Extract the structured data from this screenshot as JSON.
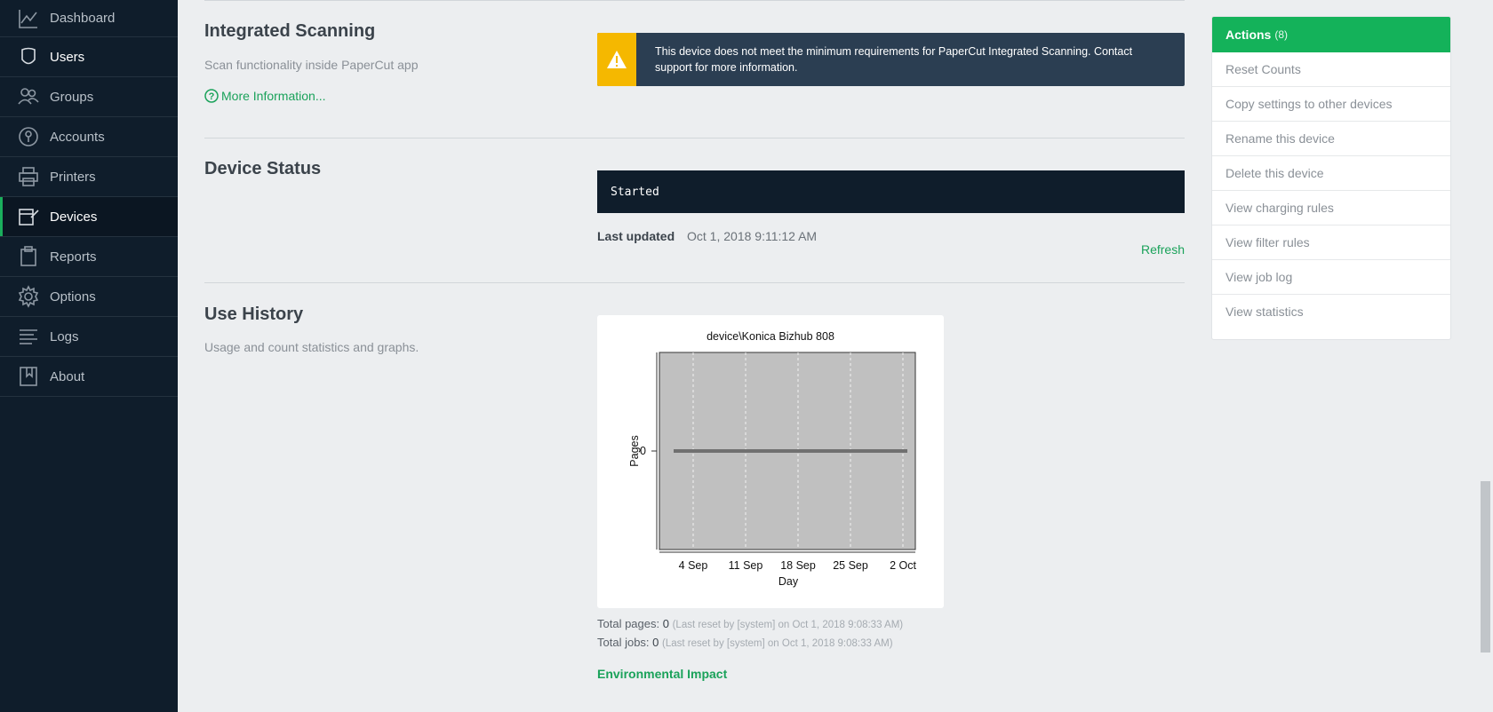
{
  "sidebar": {
    "items": [
      {
        "label": "Dashboard",
        "icon": "chart-line-icon"
      },
      {
        "label": "Users",
        "icon": "user-icon"
      },
      {
        "label": "Groups",
        "icon": "group-icon"
      },
      {
        "label": "Accounts",
        "icon": "account-icon"
      },
      {
        "label": "Printers",
        "icon": "printer-icon"
      },
      {
        "label": "Devices",
        "icon": "device-icon"
      },
      {
        "label": "Reports",
        "icon": "clipboard-icon"
      },
      {
        "label": "Options",
        "icon": "gear-icon"
      },
      {
        "label": "Logs",
        "icon": "list-icon"
      },
      {
        "label": "About",
        "icon": "book-icon"
      }
    ],
    "active": "Devices"
  },
  "scanning": {
    "title": "Integrated Scanning",
    "desc": "Scan functionality inside PaperCut app",
    "more_link": "More Information...",
    "warning": "This device does not meet the minimum requirements for PaperCut Integrated Scanning. Contact support for more information."
  },
  "status": {
    "title": "Device Status",
    "value": "Started",
    "last_updated_label": "Last updated",
    "last_updated_value": "Oct 1, 2018 9:11:12 AM",
    "refresh": "Refresh"
  },
  "history": {
    "title": "Use History",
    "desc": "Usage and count statistics and graphs.",
    "total_pages_label": "Total pages:",
    "total_pages_value": "0",
    "total_pages_note": "(Last reset by [system] on Oct 1, 2018 9:08:33 AM)",
    "total_jobs_label": "Total jobs:",
    "total_jobs_value": "0",
    "total_jobs_note": "(Last reset by [system] on Oct 1, 2018 9:08:33 AM)",
    "env_link": "Environmental Impact"
  },
  "chart_data": {
    "type": "line",
    "title": "device\\Konica Bizhub 808",
    "xlabel": "Day",
    "ylabel": "Pages",
    "x_ticks": [
      "4 Sep",
      "11 Sep",
      "18 Sep",
      "25 Sep",
      "2 Oct"
    ],
    "y_ticks": [
      "0"
    ],
    "x": [
      "1 Sep",
      "2 Oct"
    ],
    "values": [
      0,
      0
    ]
  },
  "actions": {
    "title": "Actions",
    "count": "(8)",
    "items": [
      "Reset Counts",
      "Copy settings to other devices",
      "Rename this device",
      "Delete this device",
      "View charging rules",
      "View filter rules",
      "View job log",
      "View statistics"
    ]
  }
}
